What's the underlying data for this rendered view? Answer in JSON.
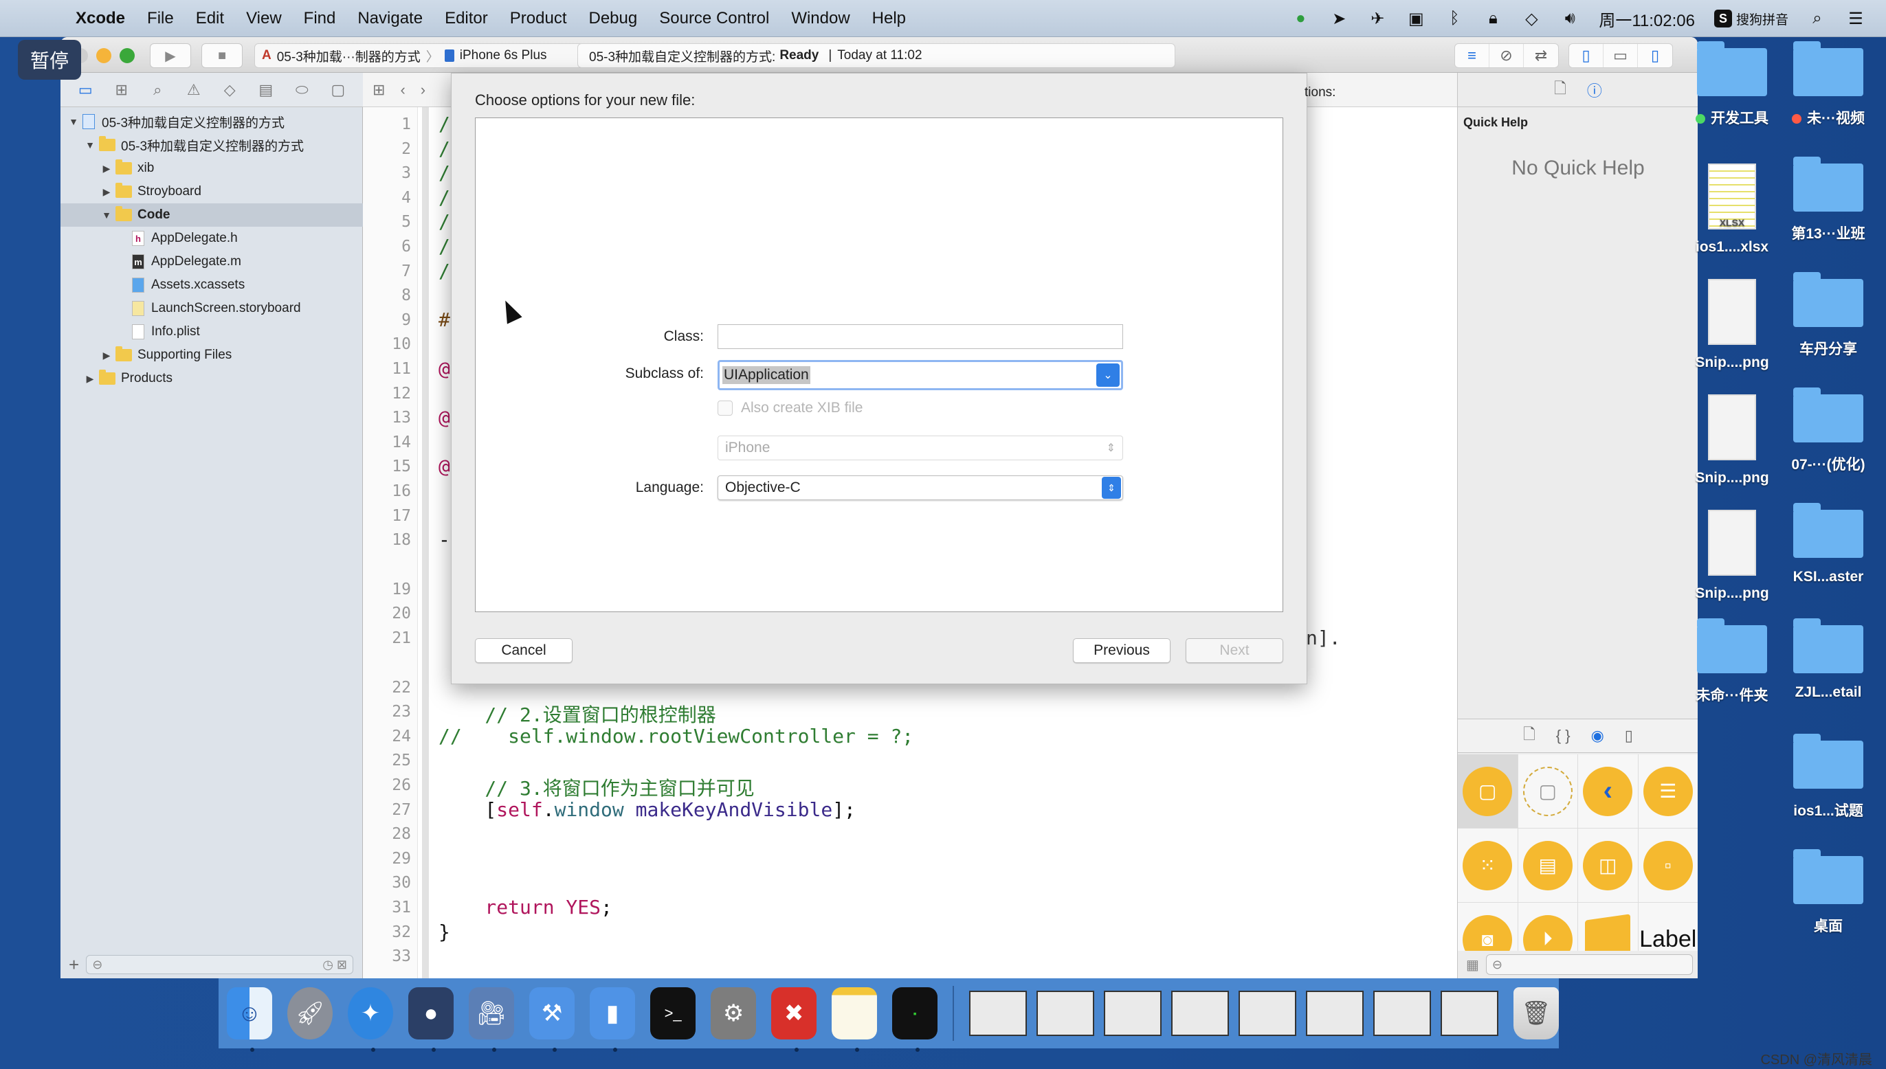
{
  "overlay": {
    "pause_badge": "暂停"
  },
  "menubar": {
    "app": "Xcode",
    "items": [
      "File",
      "Edit",
      "View",
      "Find",
      "Navigate",
      "Editor",
      "Product",
      "Debug",
      "Source Control",
      "Window",
      "Help"
    ],
    "status_icons": [
      "screen-record-icon",
      "location-icon",
      "airplane-icon",
      "facetime-camera-icon",
      "bluetooth-icon",
      "lock-icon",
      "wifi-icon",
      "volume-icon"
    ],
    "clock": "周一11:02:06",
    "input_method": "搜狗拼音",
    "spotlight": "search-icon",
    "notification": "list-icon"
  },
  "toolbar": {
    "scheme": "05-3种加载···制器的方式",
    "device": "iPhone 6s Plus",
    "activity_project": "05-3种加载自定义控制器的方式:",
    "activity_status": "Ready",
    "activity_separator": "|",
    "activity_time": "Today at 11:02"
  },
  "navigator": {
    "tabs": [
      "project-navigator",
      "symbol-navigator",
      "find-navigator",
      "issue-navigator",
      "test-navigator",
      "debug-navigator",
      "breakpoint-navigator",
      "report-navigator"
    ],
    "tree": [
      {
        "label": "05-3种加载自定义控制器的方式",
        "type": "project",
        "level": 0,
        "expanded": true
      },
      {
        "label": "05-3种加载自定义控制器的方式",
        "type": "folder",
        "level": 1,
        "expanded": true
      },
      {
        "label": "xib",
        "type": "folder",
        "level": 2,
        "expanded": false
      },
      {
        "label": "Stroyboard",
        "type": "folder",
        "level": 2,
        "expanded": false
      },
      {
        "label": "Code",
        "type": "folder",
        "level": 2,
        "expanded": true,
        "selected": true
      },
      {
        "label": "AppDelegate.h",
        "type": "h",
        "level": 3
      },
      {
        "label": "AppDelegate.m",
        "type": "m",
        "level": 3
      },
      {
        "label": "Assets.xcassets",
        "type": "assets",
        "level": 3
      },
      {
        "label": "LaunchScreen.storyboard",
        "type": "storyboard",
        "level": 3
      },
      {
        "label": "Info.plist",
        "type": "plist",
        "level": 3
      },
      {
        "label": "Supporting Files",
        "type": "folder",
        "level": 2,
        "expanded": false
      },
      {
        "label": "Products",
        "type": "folder",
        "level": 1,
        "expanded": false
      }
    ],
    "add_label": "+"
  },
  "editor": {
    "lines": [
      {
        "n": "1",
        "text": "//",
        "cls": "c-comment"
      },
      {
        "n": "2",
        "text": "//",
        "cls": "c-comment"
      },
      {
        "n": "3",
        "text": "//",
        "cls": "c-comment"
      },
      {
        "n": "4",
        "text": "//",
        "cls": "c-comment"
      },
      {
        "n": "5",
        "text": "//",
        "cls": "c-comment"
      },
      {
        "n": "6",
        "text": "//",
        "cls": "c-comment"
      },
      {
        "n": "7",
        "text": "//",
        "cls": "c-comment"
      },
      {
        "n": "8",
        "text": "",
        "cls": ""
      },
      {
        "n": "9",
        "text": "#i",
        "cls": "c-pre"
      },
      {
        "n": "10",
        "text": "",
        "cls": ""
      },
      {
        "n": "11",
        "text": "@i",
        "cls": "c-kw"
      },
      {
        "n": "12",
        "text": "",
        "cls": ""
      },
      {
        "n": "13",
        "text": "@e",
        "cls": "c-kw"
      },
      {
        "n": "14",
        "text": "",
        "cls": ""
      },
      {
        "n": "15",
        "text": "@i",
        "cls": "c-kw"
      },
      {
        "n": "16",
        "text": "",
        "cls": ""
      },
      {
        "n": "17",
        "text": "",
        "cls": ""
      },
      {
        "n": "18",
        "text": "-",
        "cls": ""
      },
      {
        "n": "19",
        "text": "",
        "cls": ""
      },
      {
        "n": "20",
        "text": "",
        "cls": ""
      },
      {
        "n": "21",
        "text": "",
        "cls": ""
      },
      {
        "n": "22",
        "text": "",
        "cls": ""
      },
      {
        "n": "23",
        "text": "    // 2.设置窗口的根控制器",
        "cls": "c-comment"
      },
      {
        "n": "24",
        "text": "//    self.window.rootViewController = ?;",
        "cls": "c-comment"
      },
      {
        "n": "25",
        "text": "",
        "cls": ""
      },
      {
        "n": "26",
        "text": "    // 3.将窗口作为主窗口并可见",
        "cls": "c-comment"
      },
      {
        "n": "27",
        "text": "",
        "cls": ""
      },
      {
        "n": "28",
        "text": "",
        "cls": ""
      },
      {
        "n": "29",
        "text": "",
        "cls": ""
      },
      {
        "n": "30",
        "text": "",
        "cls": ""
      },
      {
        "n": "31",
        "text": "",
        "cls": ""
      },
      {
        "n": "32",
        "text": "}",
        "cls": ""
      },
      {
        "n": "33",
        "text": "",
        "cls": ""
      }
    ],
    "line27": {
      "open": "    [",
      "self": "self",
      "dot": ".",
      "window": "window",
      "method": " makeKeyAndVisible",
      "close": "];"
    },
    "line31": {
      "kw": "    return",
      "val": " YES",
      "end": ";"
    },
    "line21_tail": "n]."
  },
  "dialog": {
    "title": "Choose options for your new file:",
    "right_fragment": "tions:",
    "class_label": "Class:",
    "class_value": "",
    "subclass_label": "Subclass of:",
    "subclass_value": "UIApplication",
    "xib_label": "Also create XIB file",
    "xib_checked": false,
    "device_value": "iPhone",
    "language_label": "Language:",
    "language_value": "Objective-C",
    "cancel": "Cancel",
    "previous": "Previous",
    "next": "Next"
  },
  "inspector": {
    "quick_help_title": "Quick Help",
    "no_help": "No Quick Help",
    "library_items": [
      "view-controller",
      "storyboard-reference",
      "navigation-controller",
      "table-view-controller",
      "collection-view-controller",
      "tab-bar-controller",
      "split-view-controller",
      "page-view-controller",
      "glkit-view-controller",
      "av-player-view-controller",
      "object",
      "label"
    ],
    "label_item_text": "Label"
  },
  "desktop": {
    "items": [
      {
        "label": "开发工具",
        "kind": "folder",
        "tag": "#4cd964"
      },
      {
        "label": "未···视频",
        "kind": "folder",
        "tag": "#ff5a45"
      },
      {
        "label": "ios1....xlsx",
        "kind": "xlsx"
      },
      {
        "label": "第13···业班",
        "kind": "folder"
      },
      {
        "label": "Snip....png",
        "kind": "doc"
      },
      {
        "label": "车丹分享",
        "kind": "folder"
      },
      {
        "label": "Snip....png",
        "kind": "doc"
      },
      {
        "label": "07-···(优化)",
        "kind": "folder"
      },
      {
        "label": "Snip....png",
        "kind": "doc"
      },
      {
        "label": "KSI...aster",
        "kind": "folder"
      },
      {
        "label": "未命···件夹",
        "kind": "folder"
      },
      {
        "label": "ZJL...etail",
        "kind": "folder"
      },
      {
        "label": "ios1...试题",
        "kind": "folder"
      },
      {
        "label": "桌面",
        "kind": "folder"
      }
    ],
    "xlsx_tag": "XLSX"
  },
  "dock": {
    "apps": [
      "Finder",
      "Launchpad",
      "Safari",
      "Mouse Utility",
      "Screen Recorder",
      "Xcode",
      "Simulator",
      "Terminal",
      "System Preferences",
      "XMind",
      "Notes",
      "Console"
    ],
    "windows": [
      "Window 1",
      "Window 2",
      "Window 3",
      "Window 4",
      "Window 5",
      "Window 6",
      "Window 7",
      "Window 8"
    ],
    "trash": "Trash"
  },
  "watermark": "CSDN @清风清晨"
}
